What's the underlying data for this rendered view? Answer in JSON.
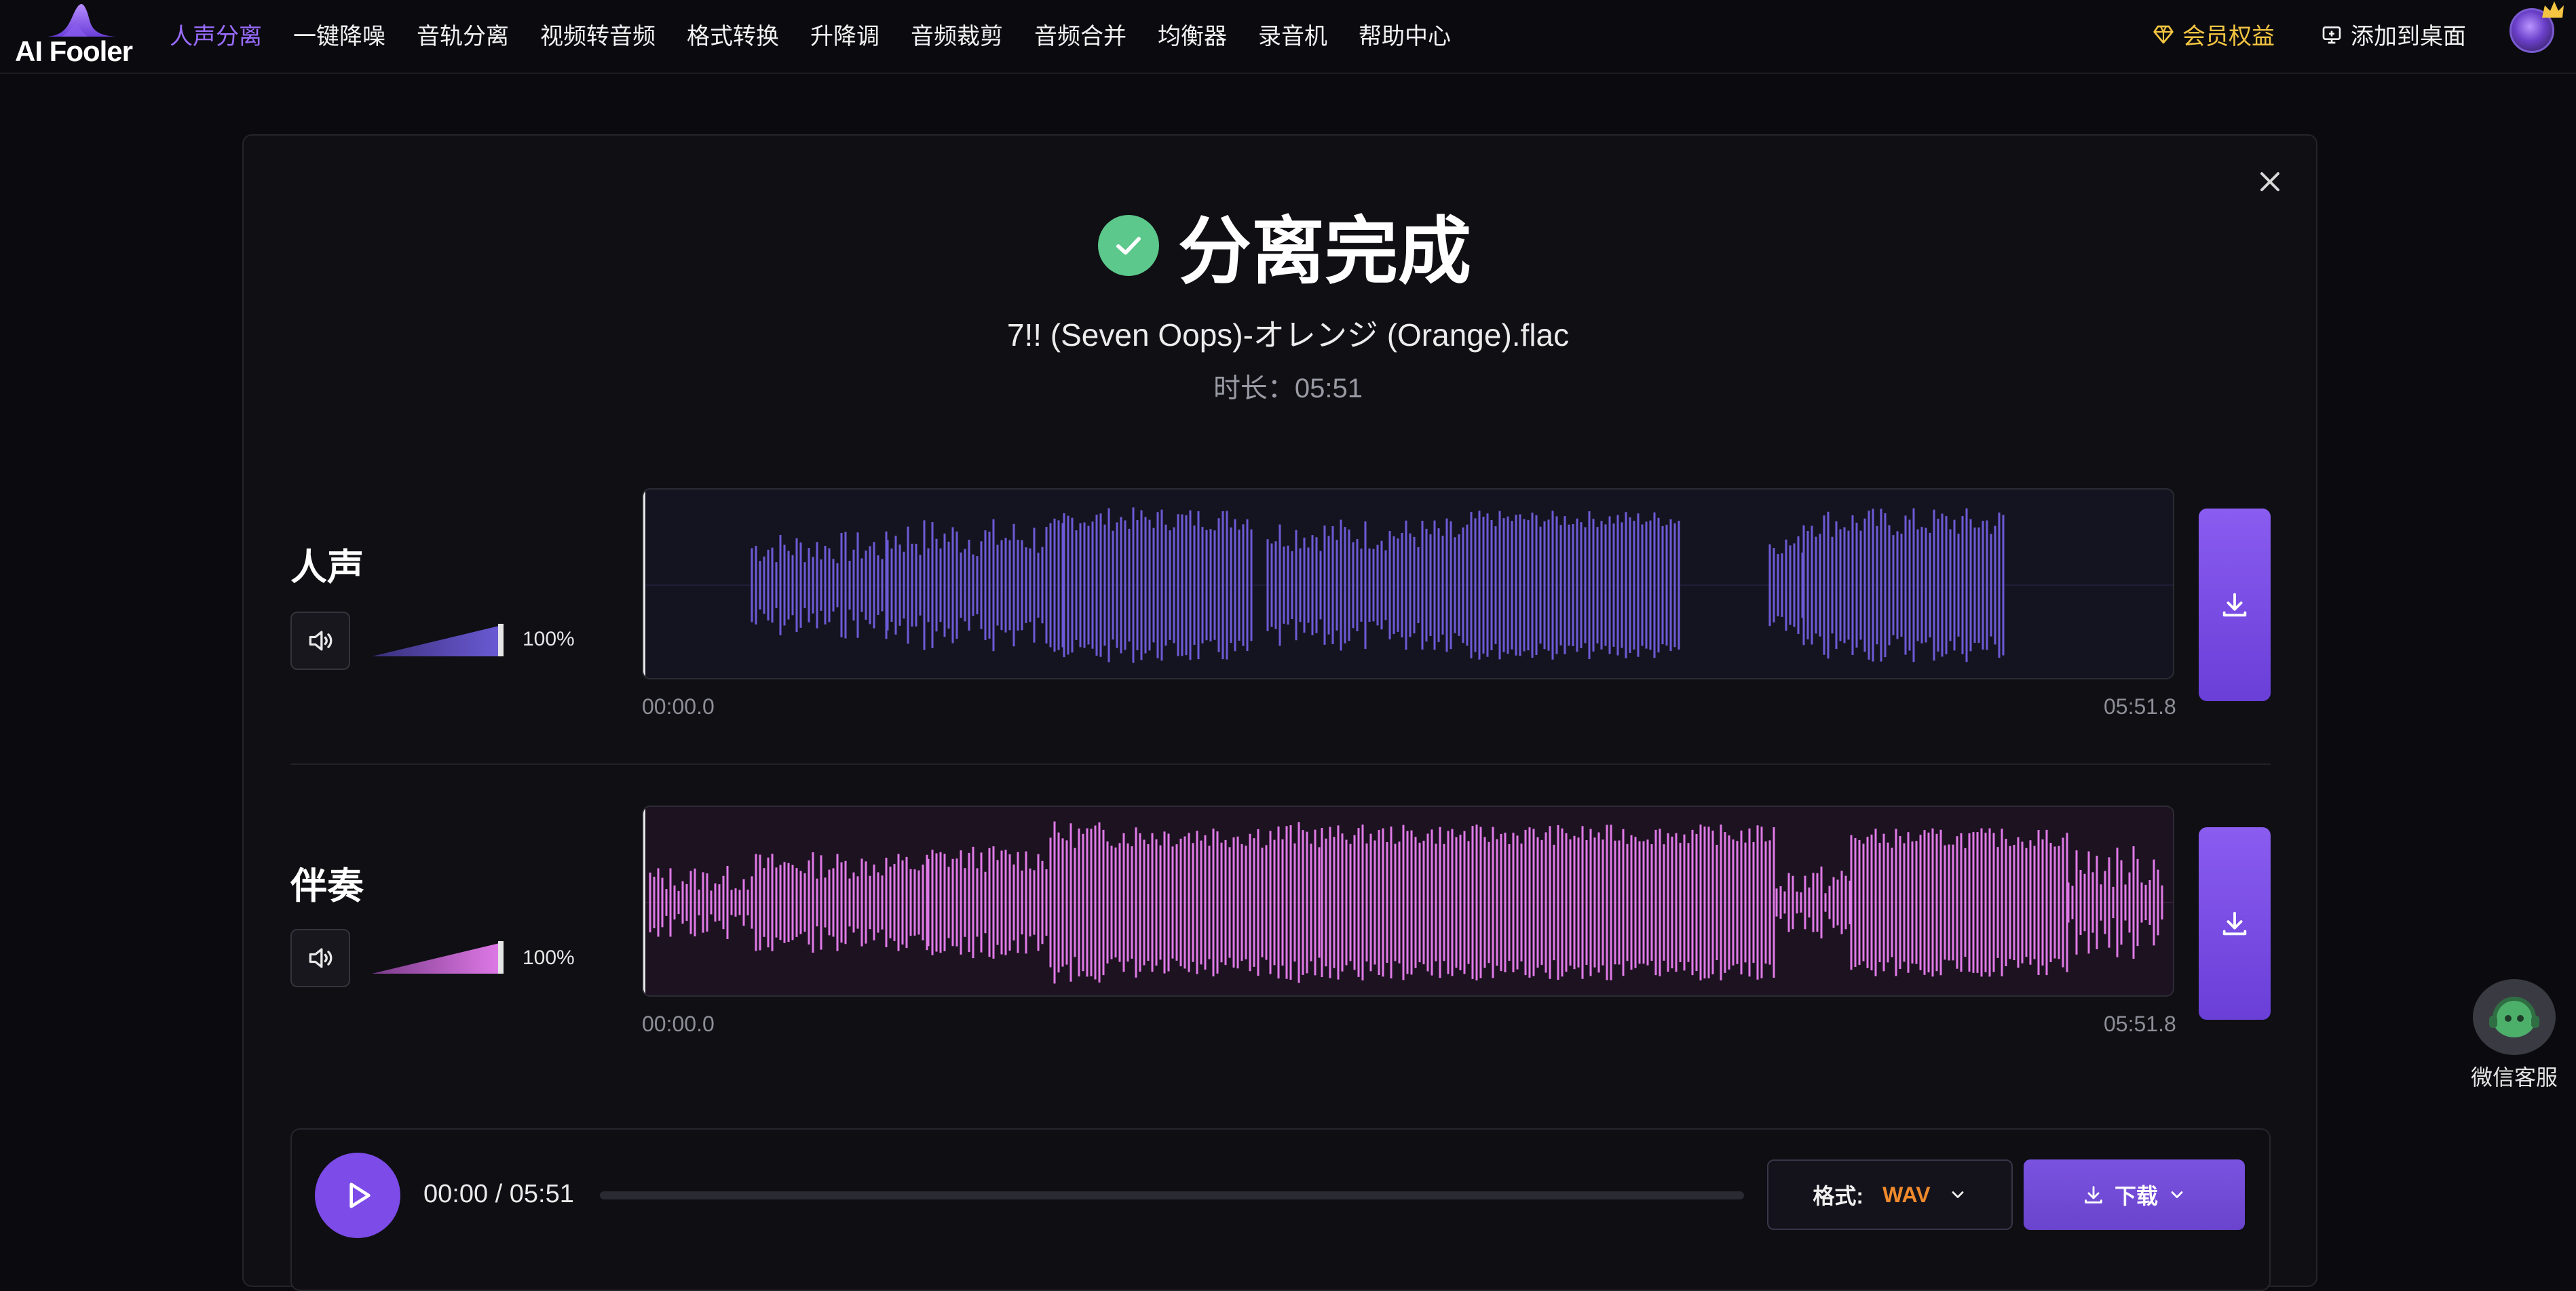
{
  "brand": {
    "name": "AI Fooler"
  },
  "nav": {
    "items": [
      {
        "label": "人声分离",
        "active": true
      },
      {
        "label": "一键降噪"
      },
      {
        "label": "音轨分离"
      },
      {
        "label": "视频转音频"
      },
      {
        "label": "格式转换"
      },
      {
        "label": "升降调"
      },
      {
        "label": "音频裁剪"
      },
      {
        "label": "音频合并"
      },
      {
        "label": "均衡器"
      },
      {
        "label": "录音机"
      },
      {
        "label": "帮助中心"
      }
    ],
    "vip_label": "会员权益",
    "add_desktop_label": "添加到桌面"
  },
  "result": {
    "title": "分离完成",
    "filename": "7!! (Seven Oops)-オレンジ (Orange).flac",
    "duration_text": "时长：05:51"
  },
  "tracks": [
    {
      "label": "人声",
      "volume": "100%",
      "start": "00:00.0",
      "end": "05:51.8",
      "color": "#6b5bd6"
    },
    {
      "label": "伴奏",
      "volume": "100%",
      "start": "00:00.0",
      "end": "05:51.8",
      "color": "#e07ae8"
    }
  ],
  "player": {
    "time": "00:00 / 05:51",
    "progress": 0,
    "format_label": "格式:",
    "format_value": "WAV",
    "download_label": "下载"
  },
  "service": {
    "label": "微信客服"
  },
  "colors": {
    "accent": "#7c4be8",
    "success": "#5cc88b",
    "vip": "#f5c542",
    "format": "#f08a2c"
  }
}
